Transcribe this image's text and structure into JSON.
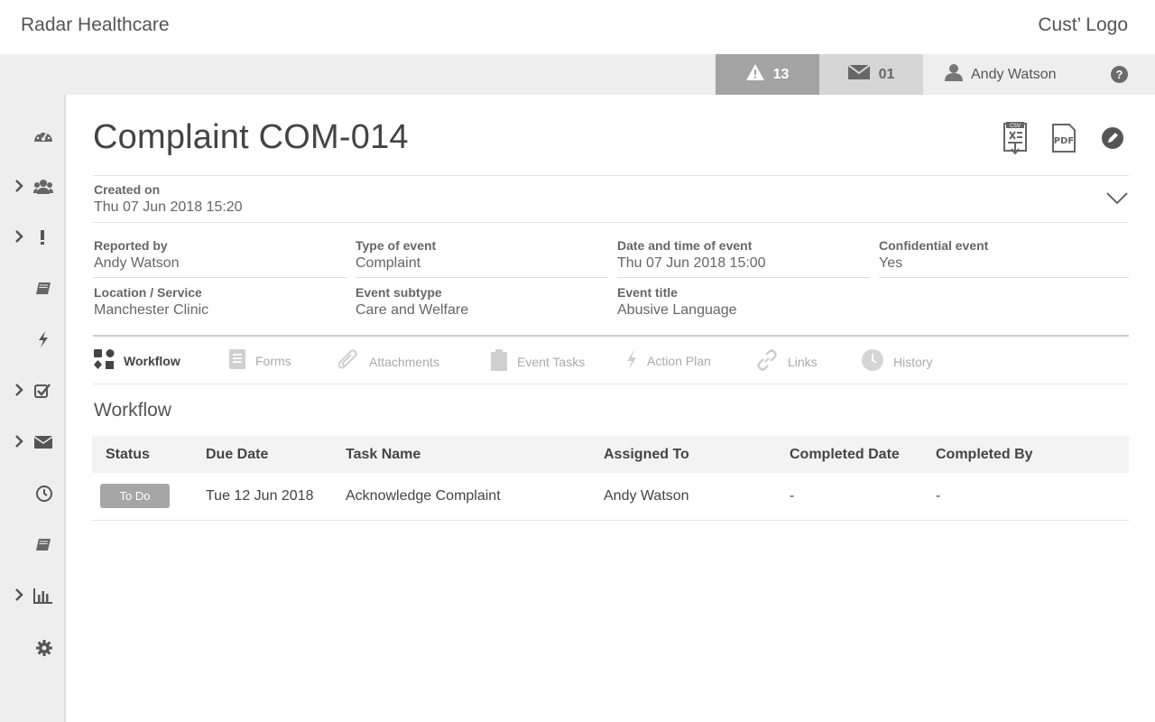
{
  "header": {
    "brand": "Radar Healthcare",
    "customer_logo": "Cust’ Logo"
  },
  "subbar": {
    "alerts_count": "13",
    "messages_count": "01",
    "user_name": "Andy Watson",
    "help_label": "?"
  },
  "sidebar": {
    "items": [
      {
        "icon": "dashboard-icon",
        "has_chevron": false
      },
      {
        "icon": "people-icon",
        "has_chevron": true
      },
      {
        "icon": "exclamation-icon",
        "has_chevron": true
      },
      {
        "icon": "book-icon",
        "has_chevron": false
      },
      {
        "icon": "lightning-icon",
        "has_chevron": false
      },
      {
        "icon": "checklist-icon",
        "has_chevron": true
      },
      {
        "icon": "envelope-icon",
        "has_chevron": true
      },
      {
        "icon": "clock-icon",
        "has_chevron": false
      },
      {
        "icon": "book-icon",
        "has_chevron": false
      },
      {
        "icon": "bar-chart-icon",
        "has_chevron": true
      },
      {
        "icon": "gear-icon",
        "has_chevron": false
      }
    ]
  },
  "page": {
    "title": "Complaint COM-014",
    "actions": [
      "csv-export-icon",
      "pdf-export-icon",
      "edit-icon"
    ]
  },
  "created": {
    "label": "Created on",
    "value": "Thu 07 Jun 2018  15:20"
  },
  "details": {
    "reported_by": {
      "label": "Reported by",
      "value": "Andy Watson"
    },
    "type_of_event": {
      "label": "Type of event",
      "value": "Complaint"
    },
    "date_time_event": {
      "label": "Date and time of event",
      "value": "Thu 07 Jun 2018   15:00"
    },
    "confidential": {
      "label": "Confidential event",
      "value": "Yes"
    },
    "location": {
      "label": "Location / Service",
      "value": "Manchester Clinic"
    },
    "event_subtype": {
      "label": "Event subtype",
      "value": "Care and Welfare"
    },
    "event_title": {
      "label": "Event title",
      "value": "Abusive Language"
    }
  },
  "tabs": [
    {
      "label": "Workflow",
      "active": true
    },
    {
      "label": "Forms",
      "active": false
    },
    {
      "label": "Attachments",
      "active": false
    },
    {
      "label": "Event Tasks",
      "active": false
    },
    {
      "label": "Action Plan",
      "active": false
    },
    {
      "label": "Links",
      "active": false
    },
    {
      "label": "History",
      "active": false
    }
  ],
  "workflow": {
    "title": "Workflow",
    "columns": [
      "Status",
      "Due Date",
      "Task Name",
      "Assigned To",
      "Completed Date",
      "Completed By"
    ],
    "rows": [
      {
        "status": "To Do",
        "due_date": "Tue 12 Jun 2018",
        "task_name": "Acknowledge Complaint",
        "assigned_to": "Andy Watson",
        "completed_date": "-",
        "completed_by": "-"
      }
    ]
  },
  "colors": {
    "alerts_bg": "#a3a3a3",
    "messages_bg": "#d6d6d6",
    "sidebar_bg": "#eeeeee",
    "badge_bg": "#a6a6a6"
  }
}
